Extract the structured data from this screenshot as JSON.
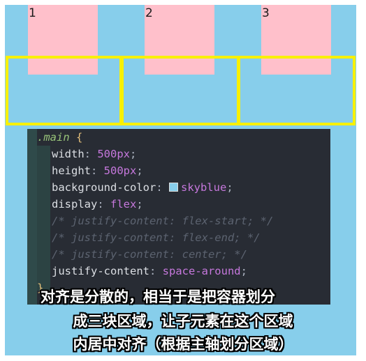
{
  "demo": {
    "background_color": "#87ceeb",
    "item_color": "#ffc0cb",
    "region_border_color": "#f8f000",
    "items": [
      {
        "label": "1"
      },
      {
        "label": "2"
      },
      {
        "label": "3"
      }
    ]
  },
  "code": {
    "selector": ".main",
    "open_brace": "{",
    "close_brace": "}",
    "lines": [
      {
        "prop": "width",
        "value": "500px"
      },
      {
        "prop": "height",
        "value": "500px"
      },
      {
        "prop": "background-color",
        "value": "skyblue"
      },
      {
        "prop": "display",
        "value": "flex"
      },
      {
        "comment": "/* justify-content: flex-start; */"
      },
      {
        "comment": "/* justify-content: flex-end; */"
      },
      {
        "comment": "/* justify-content: center; */"
      },
      {
        "prop": "justify-content",
        "value": "space-around"
      }
    ]
  },
  "annotation": {
    "line1": "对齐是分散的，相当于是把容器划分",
    "line2": "成三块区域，让子元素在这个区域",
    "line3": "内居中对齐（根据主轴划分区域）"
  }
}
